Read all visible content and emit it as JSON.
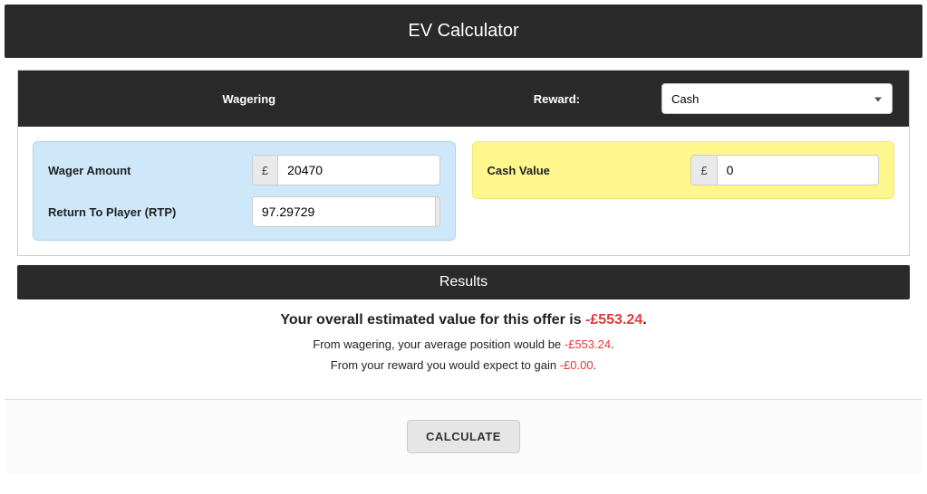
{
  "header": {
    "title": "EV Calculator"
  },
  "subheader": {
    "wagering_label": "Wagering",
    "reward_label": "Reward:",
    "reward_select_value": "Cash"
  },
  "wagering_panel": {
    "wager_amount_label": "Wager Amount",
    "wager_amount_prefix": "£",
    "wager_amount_value": "20470",
    "rtp_label": "Return To Player (RTP)",
    "rtp_value": "97.29729",
    "rtp_suffix": "%"
  },
  "reward_panel": {
    "cash_value_label": "Cash Value",
    "cash_value_prefix": "£",
    "cash_value_value": "0"
  },
  "results": {
    "header": "Results",
    "main_prefix": "Your overall estimated value for this offer is ",
    "main_value": "-£553.24",
    "line1_prefix": "From wagering, your average position would be ",
    "line1_value": "-£553.24",
    "line2_prefix": "From your reward you would expect to gain ",
    "line2_value": "-£0.00"
  },
  "footer": {
    "calculate_label": "CALCULATE"
  }
}
